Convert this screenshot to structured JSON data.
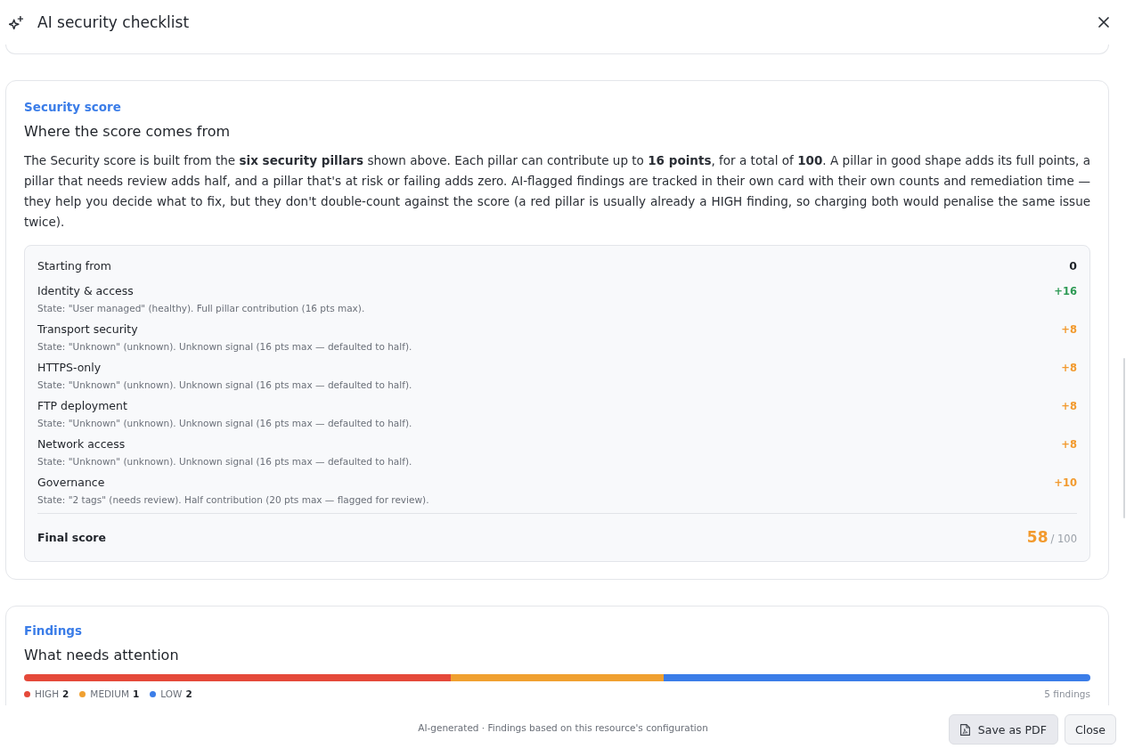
{
  "header": {
    "title": "AI security checklist"
  },
  "score_card": {
    "eyebrow": "Security score",
    "heading": "Where the score comes from",
    "description": "The Security score is built from the **six security pillars** shown above. Each pillar can contribute up to **16 points**, for a total of **100**. A pillar in good shape adds its full points, a pillar that needs review adds half, and a pillar that's at risk or failing adds zero. AI-flagged findings are tracked in their own card with their own counts and remediation time — they help you decide what to fix, but they don't double-count against the score (a red pillar is usually already a HIGH finding, so charging both would penalise the same issue twice).",
    "breakdown": {
      "start": {
        "label": "Starting from",
        "value": "0"
      },
      "pillars": [
        {
          "name": "Identity & access",
          "detail": "State: \"User managed\" (healthy). Full pillar contribution (16 pts max).",
          "points": "+16",
          "color": "#2e9a55"
        },
        {
          "name": "Transport security",
          "detail": "State: \"Unknown\" (unknown). Unknown signal (16 pts max — defaulted to half).",
          "points": "+8",
          "color": "#f29a2e"
        },
        {
          "name": "HTTPS-only",
          "detail": "State: \"Unknown\" (unknown). Unknown signal (16 pts max — defaulted to half).",
          "points": "+8",
          "color": "#f29a2e"
        },
        {
          "name": "FTP deployment",
          "detail": "State: \"Unknown\" (unknown). Unknown signal (16 pts max — defaulted to half).",
          "points": "+8",
          "color": "#f29a2e"
        },
        {
          "name": "Network access",
          "detail": "State: \"Unknown\" (unknown). Unknown signal (16 pts max — defaulted to half).",
          "points": "+8",
          "color": "#f29a2e"
        },
        {
          "name": "Governance",
          "detail": "State: \"2 tags\" (needs review). Half contribution (20 pts max — flagged for review).",
          "points": "+10",
          "color": "#f29a2e"
        }
      ],
      "final": {
        "label": "Final score",
        "value": "58",
        "max": "/ 100",
        "color": "#f29a2e"
      }
    }
  },
  "findings_card": {
    "eyebrow": "Findings",
    "heading": "What needs attention",
    "severities": [
      {
        "label": "HIGH",
        "count": "2",
        "color": "#e5493a"
      },
      {
        "label": "MEDIUM",
        "count": "1",
        "color": "#f0a030"
      },
      {
        "label": "LOW",
        "count": "2",
        "color": "#3b7de8"
      }
    ],
    "total": "5 findings"
  },
  "footer": {
    "note": "AI-generated · Findings based on this resource's configuration",
    "buttons": [
      {
        "label": "Save as PDF",
        "kind": "pdf"
      },
      {
        "label": "Close",
        "kind": "plain"
      }
    ]
  }
}
